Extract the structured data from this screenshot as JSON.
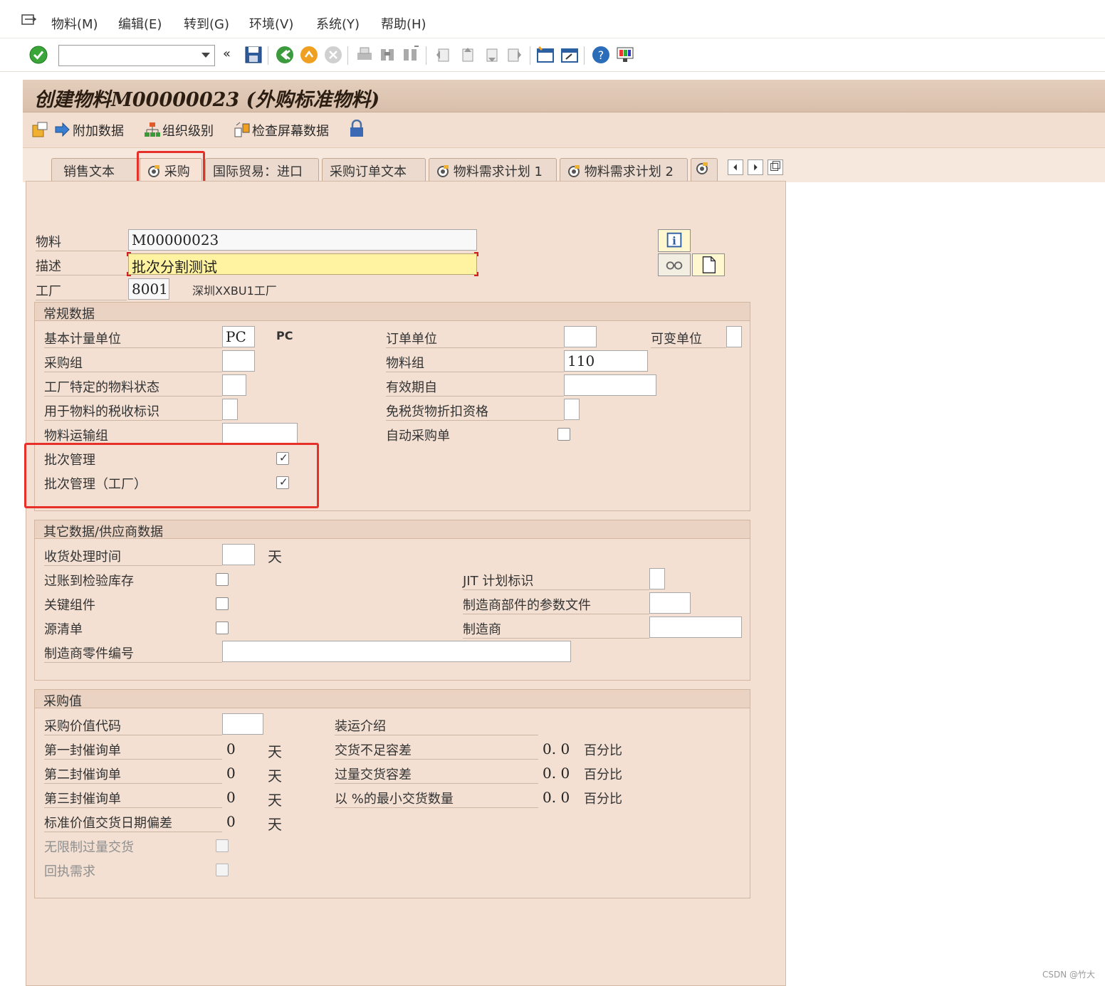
{
  "menu": {
    "items": [
      "物料(M)",
      "编辑(E)",
      "转到(G)",
      "环境(V)",
      "系统(Y)",
      "帮助(H)"
    ]
  },
  "toolbar": {
    "command_field_value": "",
    "icons": [
      "enter-icon",
      "back-icon",
      "save-icon",
      "back-green-icon",
      "exit-icon",
      "cancel-icon",
      "print-icon",
      "find-icon",
      "find-next-icon",
      "first-page-icon",
      "prev-page-icon",
      "next-page-icon",
      "last-page-icon",
      "create-session-icon",
      "shortcut-icon",
      "help-icon",
      "layout-icon"
    ]
  },
  "title": "创建物料M00000023 (外购标准物料)",
  "app_toolbar": {
    "additional_data": "附加数据",
    "org_levels": "组织级别",
    "check_screen": "检查屏幕数据"
  },
  "tabs": [
    "销售文本",
    "采购",
    "国际贸易：进口",
    "采购订单文本",
    "物料需求计划 1",
    "物料需求计划 2"
  ],
  "header": {
    "material_label": "物料",
    "material_value": "M00000023",
    "desc_label": "描述",
    "desc_value": "批次分割测试",
    "plant_label": "工厂",
    "plant_value": "8001",
    "plant_name": "深圳XXBU1工厂"
  },
  "general": {
    "title": "常规数据",
    "base_uom_label": "基本计量单位",
    "base_uom_value": "PC",
    "base_uom_text": "PC",
    "purch_group_label": "采购组",
    "plant_status_label": "工厂特定的物料状态",
    "tax_label": "用于物料的税收标识",
    "transport_label": "物料运输组",
    "batch_label": "批次管理",
    "batch_plant_label": "批次管理（工厂）",
    "order_unit_label": "订单单位",
    "var_unit_label": "可变单位",
    "mat_group_label": "物料组",
    "mat_group_value": "110",
    "valid_from_label": "有效期自",
    "tax_free_label": "免税货物折扣资格",
    "auto_po_label": "自动采购单"
  },
  "other": {
    "title": "其它数据/供应商数据",
    "gr_time_label": "收货处理时间",
    "gr_time_unit": "天",
    "post_insp_label": "过账到检验库存",
    "critical_label": "关键组件",
    "source_list_label": "源清单",
    "mpn_label": "制造商零件编号",
    "jit_label": "JIT 计划标识",
    "mpn_profile_label": "制造商部件的参数文件",
    "manufacturer_label": "制造商"
  },
  "purch_values": {
    "title": "采购值",
    "key_label": "采购价值代码",
    "rem1_label": "第一封催询单",
    "rem1_value": "0",
    "rem2_label": "第二封催询单",
    "rem2_value": "0",
    "rem3_label": "第三封催询单",
    "rem3_value": "0",
    "std_dev_label": "标准价值交货日期偏差",
    "std_dev_value": "0",
    "day_unit": "天",
    "unlimited_label": "无限制过量交货",
    "ack_label": "回执需求",
    "shipping_label": "装运介绍",
    "under_tol_label": "交货不足容差",
    "under_tol_value": "0. 0",
    "over_tol_label": "过量交货容差",
    "over_tol_value": "0. 0",
    "min_qty_label": "以 %的最小交货数量",
    "min_qty_value": "0. 0",
    "percent_unit": "百分比"
  },
  "watermark": "CSDN @竹大"
}
